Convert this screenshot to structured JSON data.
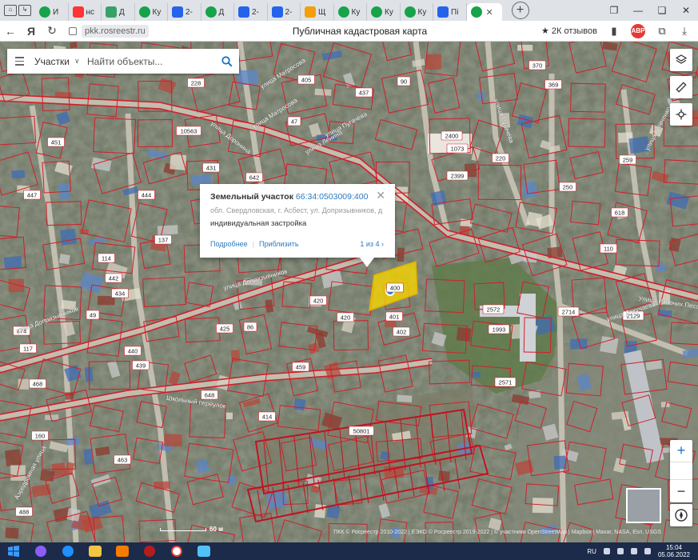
{
  "browser": {
    "tabs": [
      {
        "label": "И",
        "icon": "yandex-icon"
      },
      {
        "label": "нс",
        "icon": "yandex-icon"
      },
      {
        "label": "Д",
        "icon": "vk-icon"
      },
      {
        "label": "Ку",
        "icon": "pin-icon"
      },
      {
        "label": "2-",
        "icon": "pin-icon"
      },
      {
        "label": "Д",
        "icon": "pin-icon"
      },
      {
        "label": "2-",
        "icon": "pin-icon"
      },
      {
        "label": "2-",
        "icon": "pin-icon"
      },
      {
        "label": "Щ",
        "icon": "pin-icon"
      },
      {
        "label": "Ку",
        "icon": "pin-icon"
      },
      {
        "label": "Ку",
        "icon": "pin-icon"
      },
      {
        "label": "Ку",
        "icon": "pin-icon"
      },
      {
        "label": "Пі",
        "icon": "site-icon"
      }
    ],
    "active_tab_label": "",
    "url": "pkk.rosreestr.ru",
    "page_title": "Публичная кадастровая карта",
    "reviews": "2К отзывов",
    "adblock": "ABP"
  },
  "search": {
    "type_label": "Участки",
    "placeholder": "Найти объекты..."
  },
  "popup": {
    "title_prefix": "Земельный участок",
    "cadastral_number": "66:34:0503009:400",
    "address": "обл. Свердловская, г. Асбест, ул. Допризывников, д...",
    "usage": "индивидуальная застройка",
    "details_link": "Подробнее",
    "zoom_link": "Приблизить",
    "pager": "1 из 4"
  },
  "map": {
    "streets": [
      {
        "name": "улица Матросова"
      },
      {
        "name": "улица Матросова"
      },
      {
        "name": "улица Пугачёва"
      },
      {
        "name": "улица Доронина"
      },
      {
        "name": "улица Ленина"
      },
      {
        "name": "улица Допризывников"
      },
      {
        "name": "улица Допризывников"
      },
      {
        "name": "Школьный переулок"
      },
      {
        "name": "Аэродромная улица"
      },
      {
        "name": "улица Докучаева"
      },
      {
        "name": "улица Шевченко"
      },
      {
        "name": "улица Пугачёва"
      },
      {
        "name": "Улица Рабочих Песочная"
      }
    ],
    "parcel_labels": [
      {
        "t": "228"
      },
      {
        "t": "405"
      },
      {
        "t": "437"
      },
      {
        "t": "90"
      },
      {
        "t": "370"
      },
      {
        "t": "369"
      },
      {
        "t": "10563"
      },
      {
        "t": "47"
      },
      {
        "t": "2400"
      },
      {
        "t": "1073"
      },
      {
        "t": "250"
      },
      {
        "t": "618"
      },
      {
        "t": "2399"
      },
      {
        "t": "220"
      },
      {
        "t": "259"
      },
      {
        "t": "431"
      },
      {
        "t": "642"
      },
      {
        "t": "444"
      },
      {
        "t": "451"
      },
      {
        "t": "447"
      },
      {
        "t": "137"
      },
      {
        "t": "114"
      },
      {
        "t": "442"
      },
      {
        "t": "434"
      },
      {
        "t": "49"
      },
      {
        "t": "474"
      },
      {
        "t": "117"
      },
      {
        "t": "440"
      },
      {
        "t": "439"
      },
      {
        "t": "425"
      },
      {
        "t": "86"
      },
      {
        "t": "420"
      },
      {
        "t": "401"
      },
      {
        "t": "402"
      },
      {
        "t": "2572"
      },
      {
        "t": "1993"
      },
      {
        "t": "2571"
      },
      {
        "t": "2129"
      },
      {
        "t": "648"
      },
      {
        "t": "414"
      },
      {
        "t": "459"
      },
      {
        "t": "468"
      },
      {
        "t": "160"
      },
      {
        "t": "463"
      },
      {
        "t": "488"
      },
      {
        "t": "420"
      },
      {
        "t": "50801"
      },
      {
        "t": "110"
      },
      {
        "t": "2714"
      },
      {
        "t": "400"
      }
    ],
    "scale_label": "60 м",
    "copyright": "ПКК © Росреестр 2010-2022 | ЕЭКО © Росреестр 2019-2022 | © участники OpenStreetMap | Mapbox | Maxar, NASA, Esri, USGS"
  },
  "taskbar": {
    "lang": "RU",
    "time": "15:04",
    "date": "05.06.2022"
  },
  "colors": {
    "parcel_border": "#d11f2a",
    "selected_fill": "#f5d400",
    "link": "#2a7ac0",
    "marker": "#1e88e5"
  }
}
